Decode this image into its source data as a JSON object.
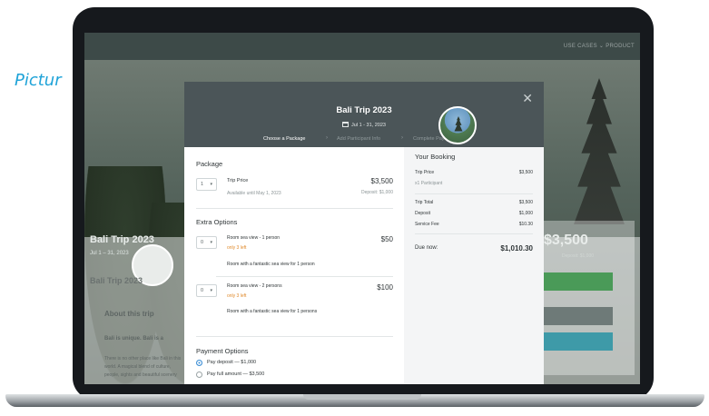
{
  "caption": "Pictur",
  "background": {
    "nav": "USE CASES ⌄   PRODUCT",
    "title": "Bali Trip 2023",
    "subtitle": "Jul 1 – 31, 2023",
    "trip_label": "Bali Trip 2023",
    "about": "About this trip",
    "bali_text": "Bali is unique. Bali is a",
    "there_text": "There is no other place like Bali in this world. A magical blend of culture, people, sights and beautiful scenery",
    "price": "$3,500",
    "fee_text": "Deposit: $1,000"
  },
  "modal": {
    "title": "Bali Trip 2023",
    "date": "Jul 1 - 31, 2023",
    "steps": [
      "Choose a Package",
      "Add Participant Info",
      "Complete Payment"
    ],
    "package": {
      "heading": "Package",
      "qty": "1",
      "name": "Trip Price",
      "available": "Available until May 1, 2023",
      "price": "$3,500",
      "deposit": "Deposit: $1,000"
    },
    "extras": {
      "heading": "Extra Options",
      "items": [
        {
          "qty": "0",
          "name": "Room sea view - 1 person",
          "left": "only 3 left",
          "desc": "Room with a fantastic sea view for 1 person",
          "price": "$50"
        },
        {
          "qty": "0",
          "name": "Room sea view - 2 persons",
          "left": "only 3 left",
          "desc": "Room with a fantastic sea view for 1 persons",
          "price": "$100"
        }
      ]
    },
    "payment": {
      "heading": "Payment Options",
      "options": [
        {
          "label": "Pay deposit — $1,000",
          "selected": true
        },
        {
          "label": "Pay full amount — $3,500",
          "selected": false
        }
      ]
    },
    "booking": {
      "heading": "Your Booking",
      "trip_label": "Trip Price",
      "trip_value": "$3,500",
      "participants": "x1 Participant",
      "rows": [
        {
          "label": "Trip Total",
          "value": "$3,500"
        },
        {
          "label": "Deposit",
          "value": "$1,000"
        },
        {
          "label": "Service Fee",
          "value": "$10.30"
        }
      ],
      "due_label": "Due now:",
      "due_value": "$1,010.30"
    }
  },
  "colors": {
    "accent": "#3d8fd6",
    "warning": "#e08b2e",
    "header": "#4b5558",
    "caption": "#1fa3d8"
  }
}
